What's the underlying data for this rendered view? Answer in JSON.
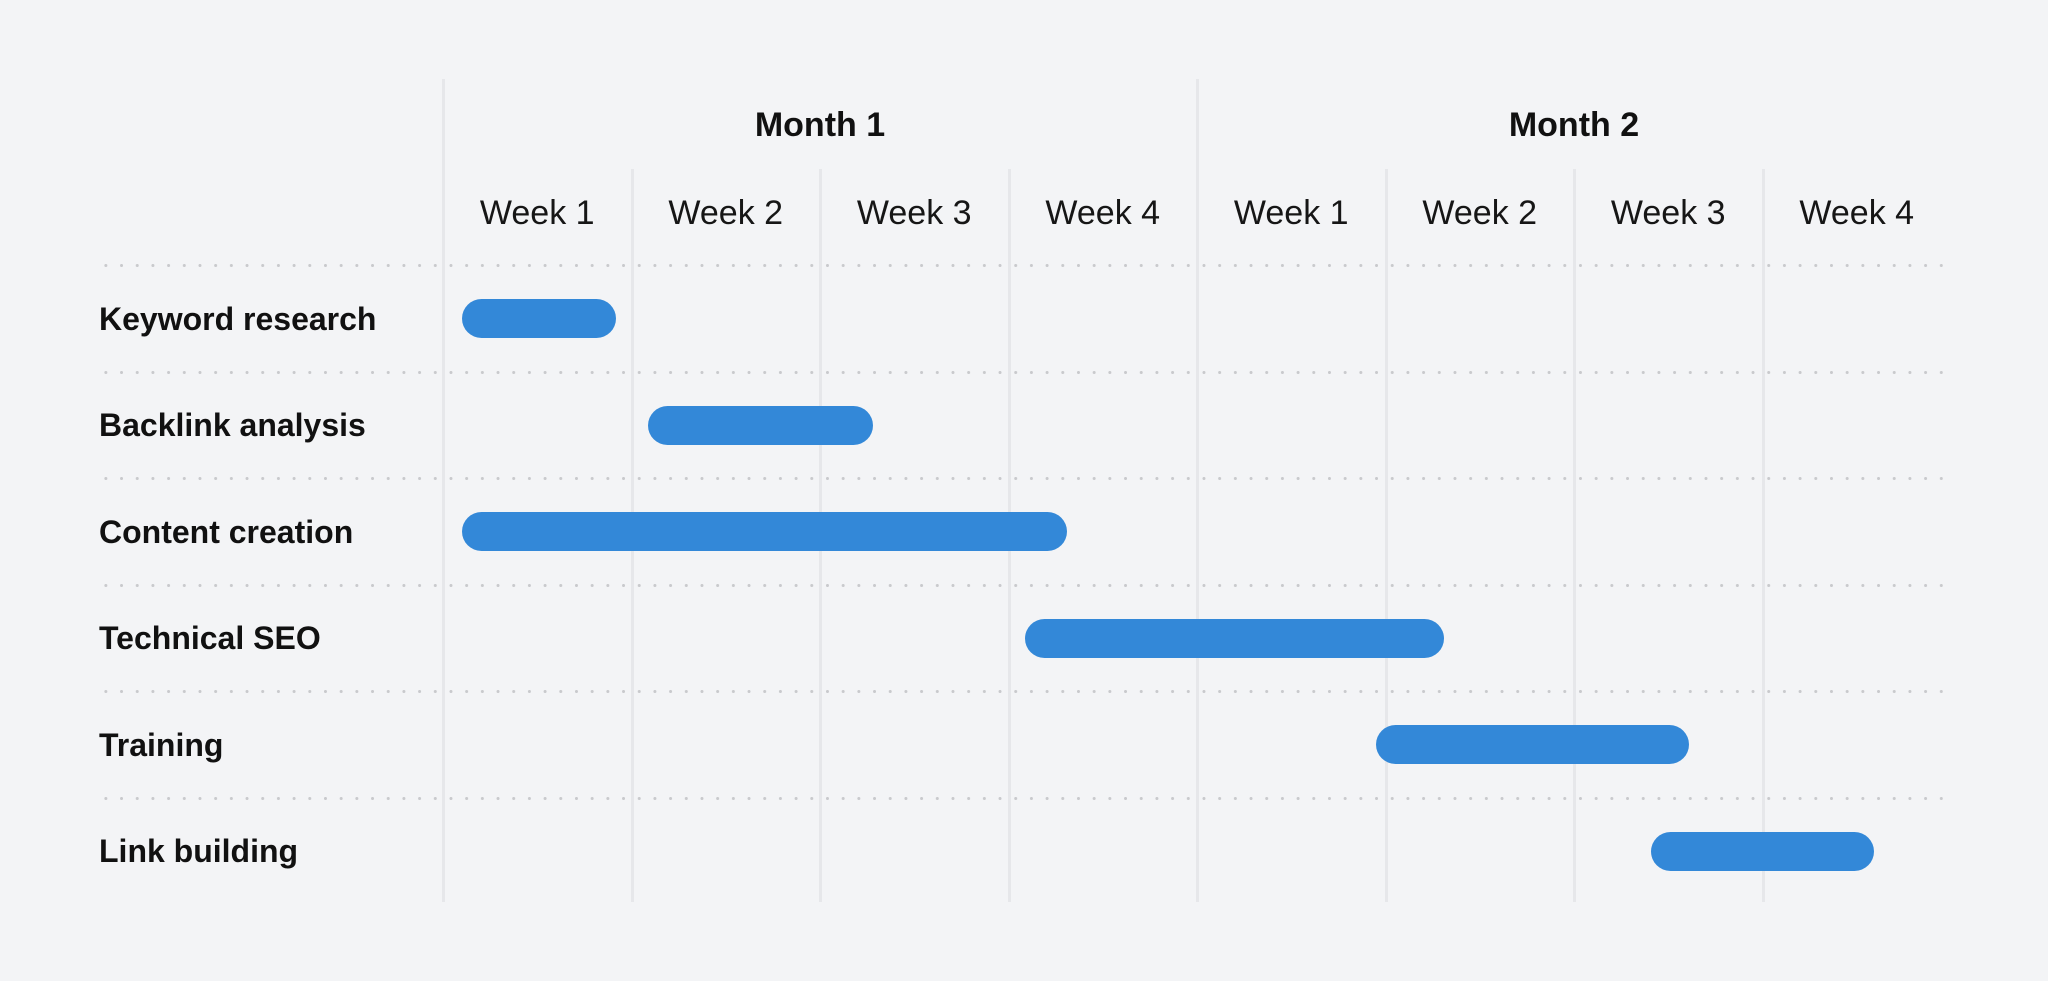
{
  "chart_data": {
    "type": "gantt",
    "title": "",
    "bar_color": "#3388d8",
    "background_color": "#f3f4f6",
    "months": [
      {
        "label": "Month 1",
        "weeks": 4
      },
      {
        "label": "Month 2",
        "weeks": 4
      }
    ],
    "weeks": [
      "Week 1",
      "Week 2",
      "Week 3",
      "Week 4",
      "Week 1",
      "Week 2",
      "Week 3",
      "Week 4"
    ],
    "x_unit": "weeks from start",
    "xlim": [
      0,
      8
    ],
    "tasks": [
      {
        "name": "Keyword research",
        "start": 0.1,
        "end": 0.92
      },
      {
        "name": "Backlink analysis",
        "start": 1.09,
        "end": 2.28
      },
      {
        "name": "Content creation",
        "start": 0.1,
        "end": 3.31
      },
      {
        "name": "Technical SEO",
        "start": 3.09,
        "end": 5.31
      },
      {
        "name": "Training",
        "start": 4.95,
        "end": 6.61
      },
      {
        "name": "Link building",
        "start": 6.41,
        "end": 7.59
      }
    ]
  }
}
